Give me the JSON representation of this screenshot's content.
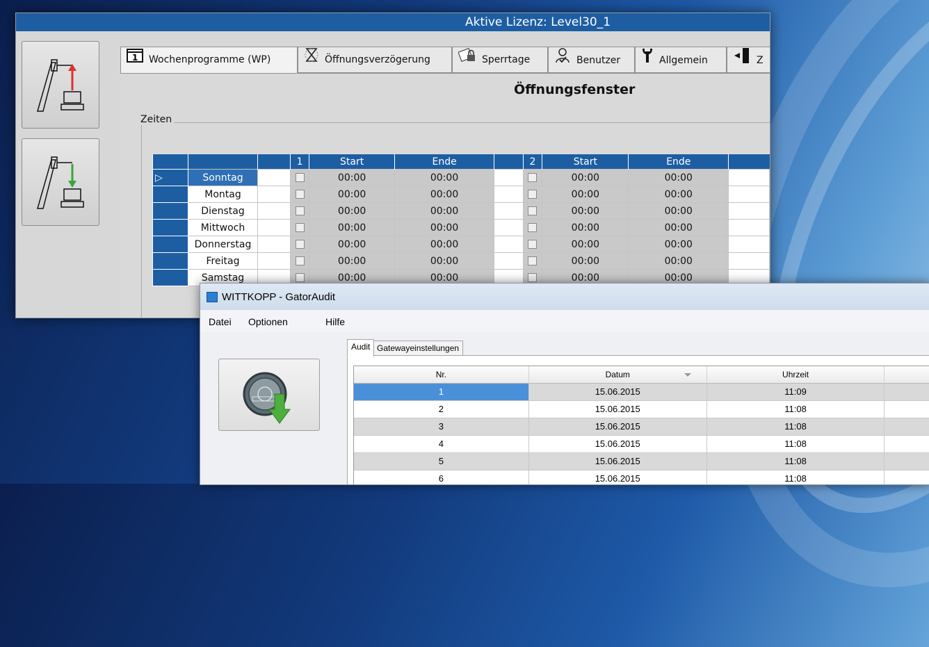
{
  "background": {
    "accent": "#1d5ea3"
  },
  "main_window": {
    "license_text": "Aktive Lizenz:  Level30_1",
    "side_buttons": [
      {
        "name": "upload-to-lock-button",
        "icon": "lock-upload-icon",
        "arrow_color": "#e03030"
      },
      {
        "name": "download-from-lock-button",
        "icon": "lock-download-icon",
        "arrow_color": "#3aa63a"
      }
    ],
    "tabs": [
      {
        "label": "Wochenprogramme (WP)",
        "icon": "calendar-icon",
        "active": true
      },
      {
        "label": "Öffnungsverzögerung",
        "icon": "hourglass-icon"
      },
      {
        "label": "Sperrtage",
        "icon": "calendar-lock-icon"
      },
      {
        "label": "Benutzer",
        "icon": "user-icon"
      },
      {
        "label": "Allgemein",
        "icon": "wrench-icon"
      },
      {
        "label": "Z",
        "icon": "door-icon"
      }
    ],
    "section_title": "Öffnungsfenster",
    "group_label": "Zeiten",
    "table": {
      "headers": [
        "",
        "",
        "1",
        "Start",
        "Ende",
        "",
        "2",
        "Start",
        "Ende",
        ""
      ],
      "rows": [
        {
          "day": "Sonntag",
          "start1": "00:00",
          "end1": "00:00",
          "start2": "00:00",
          "end2": "00:00"
        },
        {
          "day": "Montag",
          "start1": "00:00",
          "end1": "00:00",
          "start2": "00:00",
          "end2": "00:00"
        },
        {
          "day": "Dienstag",
          "start1": "00:00",
          "end1": "00:00",
          "start2": "00:00",
          "end2": "00:00"
        },
        {
          "day": "Mittwoch",
          "start1": "00:00",
          "end1": "00:00",
          "start2": "00:00",
          "end2": "00:00"
        },
        {
          "day": "Donnerstag",
          "start1": "00:00",
          "end1": "00:00",
          "start2": "00:00",
          "end2": "00:00"
        },
        {
          "day": "Freitag",
          "start1": "00:00",
          "end1": "00:00",
          "start2": "00:00",
          "end2": "00:00"
        },
        {
          "day": "Samstag",
          "start1": "00:00",
          "end1": "00:00",
          "start2": "00:00",
          "end2": "00:00"
        }
      ],
      "row_indicator": "▷"
    }
  },
  "audit_window": {
    "title": "WITTKOPP - GatorAudit",
    "menu": [
      "Datei",
      "Optionen",
      "Hilfe"
    ],
    "tabs": [
      "Audit",
      "Gatewayeinstellungen"
    ],
    "button_icon": "coin-download-icon",
    "columns": [
      "Nr.",
      "Datum",
      "Uhrzeit",
      ""
    ],
    "rows": [
      {
        "nr": "1",
        "datum": "15.06.2015",
        "uhrzeit": "11:09"
      },
      {
        "nr": "2",
        "datum": "15.06.2015",
        "uhrzeit": "11:08"
      },
      {
        "nr": "3",
        "datum": "15.06.2015",
        "uhrzeit": "11:08"
      },
      {
        "nr": "4",
        "datum": "15.06.2015",
        "uhrzeit": "11:08"
      },
      {
        "nr": "5",
        "datum": "15.06.2015",
        "uhrzeit": "11:08"
      },
      {
        "nr": "6",
        "datum": "15.06.2015",
        "uhrzeit": "11:08"
      }
    ]
  }
}
